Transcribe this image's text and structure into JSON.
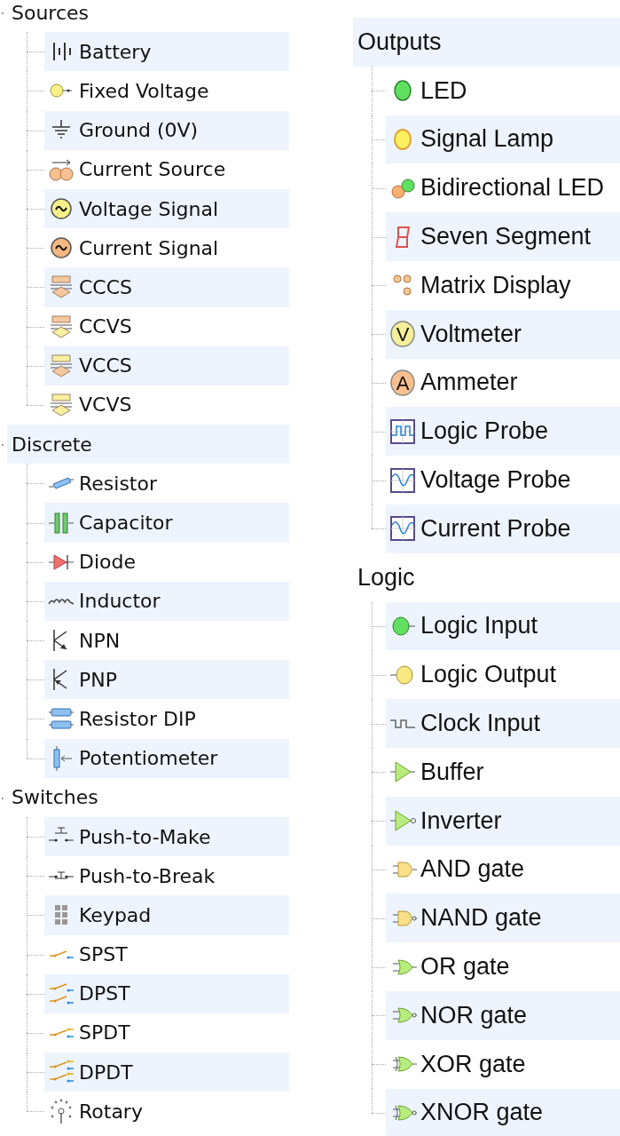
{
  "columns": [
    {
      "groups": [
        {
          "label": "Sources",
          "children": [
            {
              "label": "Battery",
              "kind": "battery"
            },
            {
              "label": "Fixed Voltage",
              "kind": "fixed-voltage"
            },
            {
              "label": "Ground (0V)",
              "kind": "ground"
            },
            {
              "label": "Current Source",
              "kind": "current-source"
            },
            {
              "label": "Voltage Signal",
              "kind": "voltage-signal"
            },
            {
              "label": "Current Signal",
              "kind": "current-signal"
            },
            {
              "label": "CCCS",
              "kind": "cccs"
            },
            {
              "label": "CCVS",
              "kind": "ccvs"
            },
            {
              "label": "VCCS",
              "kind": "vccs"
            },
            {
              "label": "VCVS",
              "kind": "vcvs"
            }
          ]
        },
        {
          "label": "Discrete",
          "children": [
            {
              "label": "Resistor",
              "kind": "resistor"
            },
            {
              "label": "Capacitor",
              "kind": "capacitor"
            },
            {
              "label": "Diode",
              "kind": "diode"
            },
            {
              "label": "Inductor",
              "kind": "inductor"
            },
            {
              "label": "NPN",
              "kind": "npn"
            },
            {
              "label": "PNP",
              "kind": "pnp"
            },
            {
              "label": "Resistor DIP",
              "kind": "resistor-dip"
            },
            {
              "label": "Potentiometer",
              "kind": "potentiometer"
            }
          ]
        },
        {
          "label": "Switches",
          "children": [
            {
              "label": "Push-to-Make",
              "kind": "push-make"
            },
            {
              "label": "Push-to-Break",
              "kind": "push-break"
            },
            {
              "label": "Keypad",
              "kind": "keypad"
            },
            {
              "label": "SPST",
              "kind": "spst"
            },
            {
              "label": "DPST",
              "kind": "dpst"
            },
            {
              "label": "SPDT",
              "kind": "spdt"
            },
            {
              "label": "DPDT",
              "kind": "dpdt"
            },
            {
              "label": "Rotary",
              "kind": "rotary"
            }
          ]
        }
      ]
    },
    {
      "groups": [
        {
          "label": "Outputs",
          "children": [
            {
              "label": "LED",
              "kind": "led"
            },
            {
              "label": "Signal Lamp",
              "kind": "lamp"
            },
            {
              "label": "Bidirectional LED",
              "kind": "bi-led"
            },
            {
              "label": "Seven Segment",
              "kind": "seven-segment"
            },
            {
              "label": "Matrix Display",
              "kind": "matrix"
            },
            {
              "label": "Voltmeter",
              "kind": "voltmeter",
              "icon_text": "V"
            },
            {
              "label": "Ammeter",
              "kind": "ammeter",
              "icon_text": "A"
            },
            {
              "label": "Logic Probe",
              "kind": "logic-probe"
            },
            {
              "label": "Voltage Probe",
              "kind": "voltage-probe"
            },
            {
              "label": "Current Probe",
              "kind": "current-probe"
            }
          ]
        },
        {
          "label": "Logic",
          "children": [
            {
              "label": "Logic Input",
              "kind": "logic-input"
            },
            {
              "label": "Logic Output",
              "kind": "logic-output"
            },
            {
              "label": "Clock Input",
              "kind": "clock"
            },
            {
              "label": "Buffer",
              "kind": "buffer"
            },
            {
              "label": "Inverter",
              "kind": "inverter"
            },
            {
              "label": "AND gate",
              "kind": "and"
            },
            {
              "label": "NAND gate",
              "kind": "nand"
            },
            {
              "label": "OR gate",
              "kind": "or"
            },
            {
              "label": "NOR gate",
              "kind": "nor"
            },
            {
              "label": "XOR gate",
              "kind": "xor"
            },
            {
              "label": "XNOR gate",
              "kind": "xnor"
            }
          ]
        }
      ]
    }
  ]
}
